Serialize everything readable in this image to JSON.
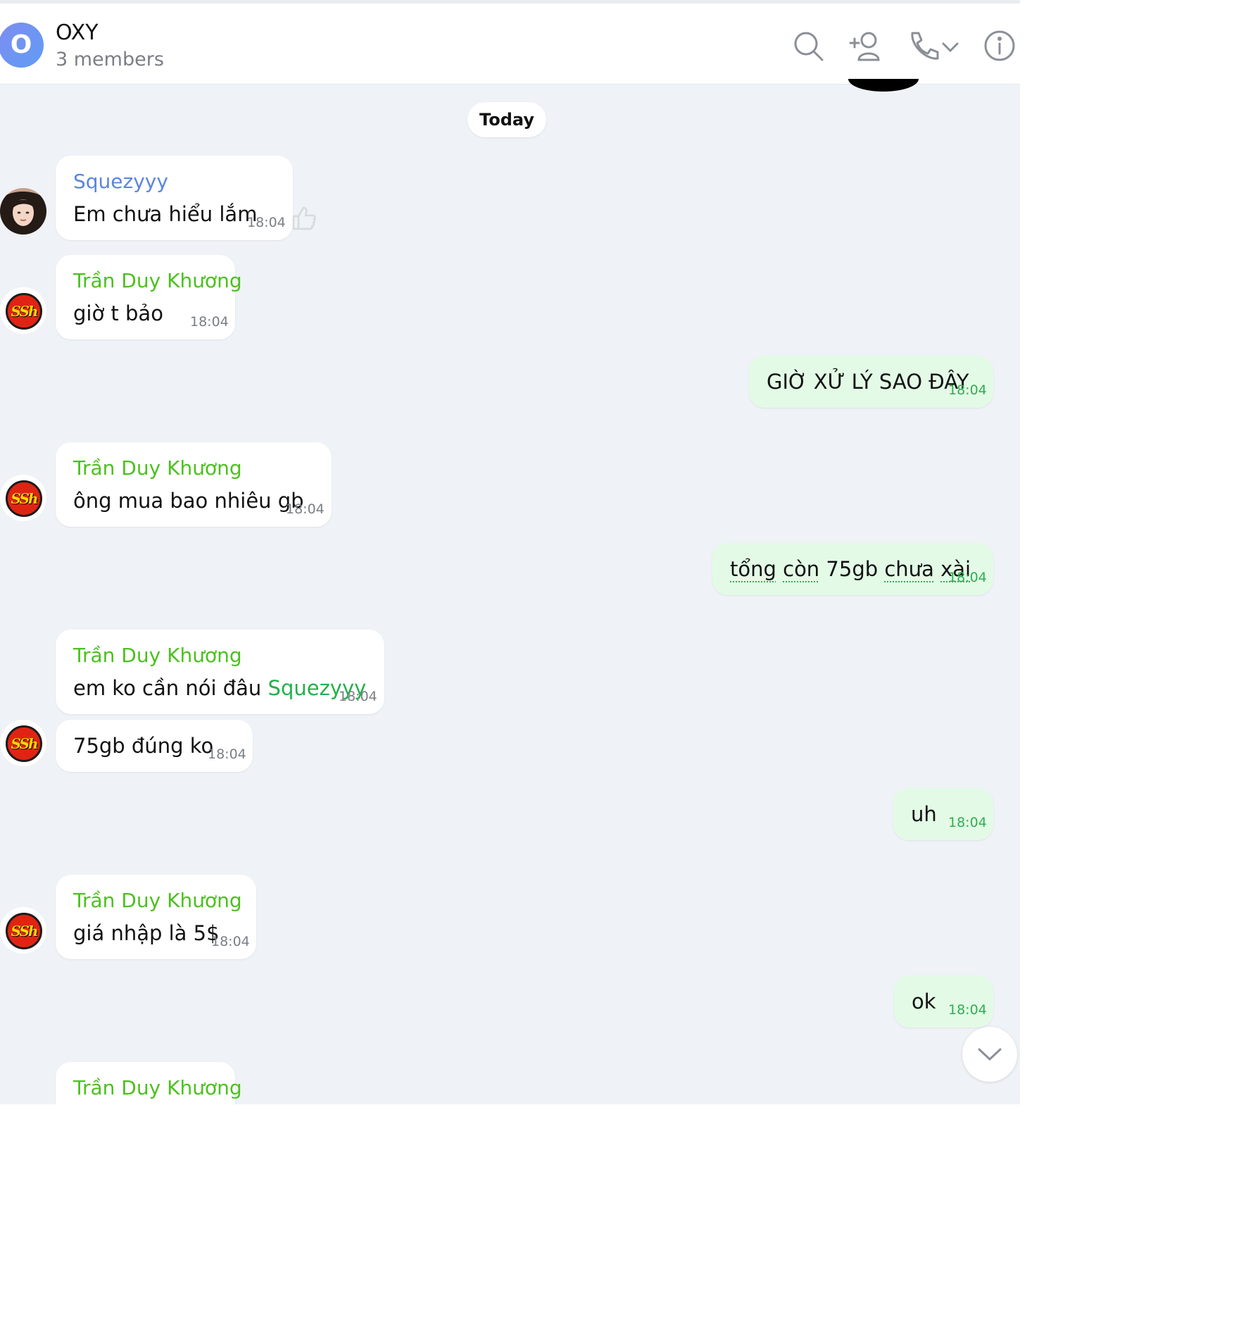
{
  "header": {
    "avatar_letter": "O",
    "title": "OXY",
    "subtitle": "3 members",
    "icons": [
      "search-icon",
      "add-member-icon",
      "call-icon",
      "chevron-down-icon",
      "info-icon"
    ]
  },
  "divider": {
    "label": "Today"
  },
  "messages": [
    {
      "sender": "Squezyyy",
      "text": "Em chưa hiểu lắm",
      "time": "18:04"
    },
    {
      "sender": "Trần Duy Khương",
      "text": "giờ t bảo",
      "time": "18:04"
    },
    {
      "text": "GIỜ XỬ LÝ SAO ĐÂY",
      "time": "18:04"
    },
    {
      "sender": "Trần Duy Khương",
      "text": "ông mua bao nhiêu gb",
      "time": "18:04"
    },
    {
      "parts": [
        "tổng",
        " ",
        "còn",
        " 75gb ",
        "chưa",
        " ",
        "xài"
      ],
      "time": "18:04"
    },
    {
      "sender": "Trần Duy Khương",
      "text": "em ko cần nói đâu ",
      "mention": "Squezyyy",
      "time": "18:04"
    },
    {
      "text": "75gb đúng ko",
      "time": "18:04"
    },
    {
      "text": "uh",
      "time": "18:04"
    },
    {
      "sender": "Trần Duy Khương",
      "text": "giá nhập là 5$",
      "time": "18:04"
    },
    {
      "text": "ok",
      "time": "18:04"
    },
    {
      "sender": "Trần Duy Khương"
    }
  ],
  "avatars": {
    "ssh_badge": "SSh"
  },
  "colors": {
    "background": "#eff2f6",
    "mine_bubble": "#e3fbe6",
    "sender_blue": "#5a86df",
    "sender_green": "#4cc11e",
    "mine_time": "#2fae52"
  }
}
